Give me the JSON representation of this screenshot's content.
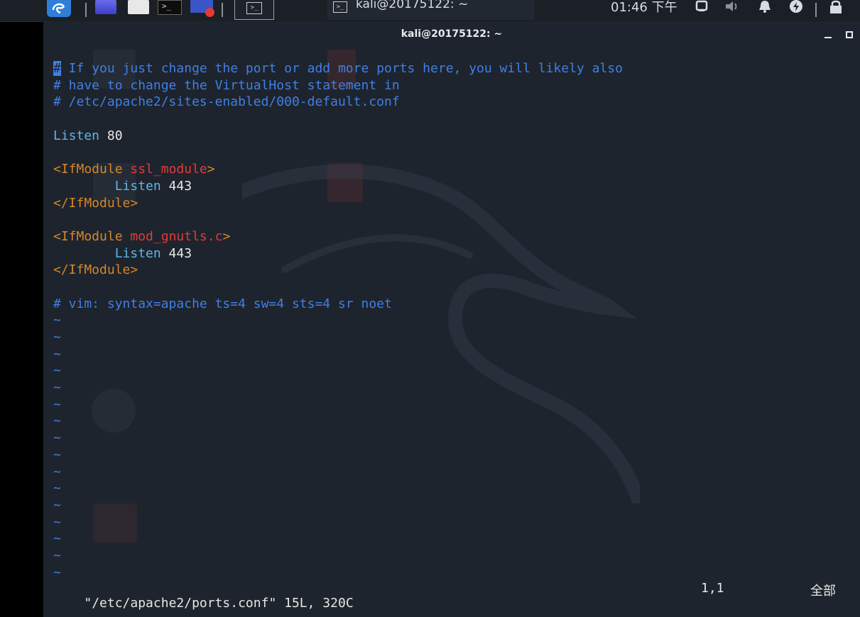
{
  "panel": {
    "task_title": "kali@20175122: ~",
    "clock": "01:46 下午",
    "icons": [
      "kali-menu-icon",
      "window-icon",
      "file-manager-icon",
      "terminal-icon",
      "screen-recorder-icon",
      "workspace-icon",
      "network-icon",
      "volume-icon",
      "notification-icon",
      "power-icon",
      "lock-icon"
    ]
  },
  "window": {
    "title": "kali@20175122: ~"
  },
  "editor": {
    "lines": [
      {
        "parts": [
          {
            "t": "#",
            "c": "cursor"
          },
          {
            "t": " If you just change the port or add more ports here, you will likely also",
            "c": "c-com"
          }
        ]
      },
      {
        "parts": [
          {
            "t": "# have to change the VirtualHost statement in",
            "c": "c-com"
          }
        ]
      },
      {
        "parts": [
          {
            "t": "# /etc/apache2/sites-enabled/000-default.conf",
            "c": "c-com"
          }
        ]
      },
      {
        "parts": [
          {
            "t": "",
            "c": ""
          }
        ]
      },
      {
        "parts": [
          {
            "t": "Listen",
            "c": "c-key"
          },
          {
            "t": " 80",
            "c": "c-num"
          }
        ]
      },
      {
        "parts": [
          {
            "t": "",
            "c": ""
          }
        ]
      },
      {
        "parts": [
          {
            "t": "<IfModule",
            "c": "c-tag"
          },
          {
            "t": " ssl_module",
            "c": "c-red"
          },
          {
            "t": ">",
            "c": "c-tag"
          }
        ]
      },
      {
        "parts": [
          {
            "t": "        Listen",
            "c": "c-key"
          },
          {
            "t": " 443",
            "c": "c-num"
          }
        ]
      },
      {
        "parts": [
          {
            "t": "</IfModule>",
            "c": "c-tag"
          }
        ]
      },
      {
        "parts": [
          {
            "t": "",
            "c": ""
          }
        ]
      },
      {
        "parts": [
          {
            "t": "<IfModule",
            "c": "c-tag"
          },
          {
            "t": " mod_gnutls.c",
            "c": "c-red"
          },
          {
            "t": ">",
            "c": "c-tag"
          }
        ]
      },
      {
        "parts": [
          {
            "t": "        Listen",
            "c": "c-key"
          },
          {
            "t": " 443",
            "c": "c-num"
          }
        ]
      },
      {
        "parts": [
          {
            "t": "</IfModule>",
            "c": "c-tag"
          }
        ]
      },
      {
        "parts": [
          {
            "t": "",
            "c": ""
          }
        ]
      },
      {
        "parts": [
          {
            "t": "# vim: syntax=apache ts=4 sw=4 sts=4 sr noet",
            "c": "c-com"
          }
        ]
      }
    ],
    "tilde_count": 16,
    "tilde": "~",
    "status_file": "\"/etc/apache2/ports.conf\" 15L, 320C",
    "status_pos": "1,1",
    "status_all": "全部"
  },
  "colors": {
    "comment": "#3f7fe6",
    "keyword": "#5fb6e8",
    "tag": "#d4872a",
    "module": "#e03b3b",
    "background": "#1e242d"
  }
}
